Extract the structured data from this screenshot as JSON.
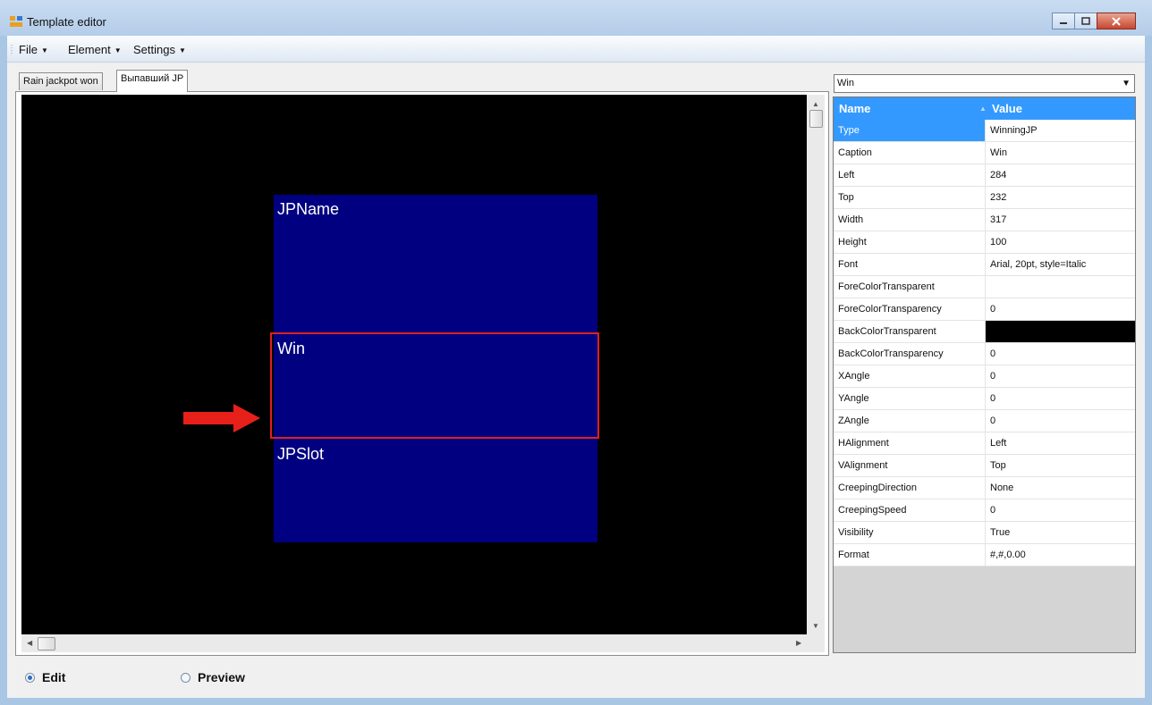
{
  "window": {
    "title": "Template editor"
  },
  "menu": [
    {
      "label": "File"
    },
    {
      "label": "Element"
    },
    {
      "label": "Settings"
    }
  ],
  "tabs": [
    {
      "label": "Rain jackpot won",
      "active": false
    },
    {
      "label": "Выпавший JP",
      "active": true
    }
  ],
  "canvas": {
    "background": "#000000",
    "element_color": "#000080",
    "selection_color": "#e02020",
    "elements": [
      {
        "caption": "JPName"
      },
      {
        "caption": "Win",
        "selected": true
      },
      {
        "caption": "JPSlot"
      }
    ]
  },
  "element_selector": {
    "value": "Win"
  },
  "property_grid": {
    "header_name": "Name",
    "header_value": "Value",
    "rows": [
      {
        "name": "Type",
        "value": "WinningJP",
        "selected": true
      },
      {
        "name": "Caption",
        "value": "Win"
      },
      {
        "name": "Left",
        "value": "284"
      },
      {
        "name": "Top",
        "value": "232"
      },
      {
        "name": "Width",
        "value": "317"
      },
      {
        "name": "Height",
        "value": "100"
      },
      {
        "name": "Font",
        "value": "Arial, 20pt, style=Italic"
      },
      {
        "name": "ForeColorTransparent",
        "value": ""
      },
      {
        "name": "ForeColorTransparency",
        "value": "0"
      },
      {
        "name": "BackColorTransparent",
        "value": "",
        "color": "#000000"
      },
      {
        "name": "BackColorTransparency",
        "value": "0"
      },
      {
        "name": "XAngle",
        "value": "0"
      },
      {
        "name": "YAngle",
        "value": "0"
      },
      {
        "name": "ZAngle",
        "value": "0"
      },
      {
        "name": "HAlignment",
        "value": "Left"
      },
      {
        "name": "VAlignment",
        "value": "Top"
      },
      {
        "name": "CreepingDirection",
        "value": "None"
      },
      {
        "name": "CreepingSpeed",
        "value": "0"
      },
      {
        "name": "Visibility",
        "value": "True"
      },
      {
        "name": "Format",
        "value": "#,#,0.00"
      }
    ]
  },
  "mode": {
    "edit_label": "Edit",
    "preview_label": "Preview",
    "selected": "Edit"
  }
}
